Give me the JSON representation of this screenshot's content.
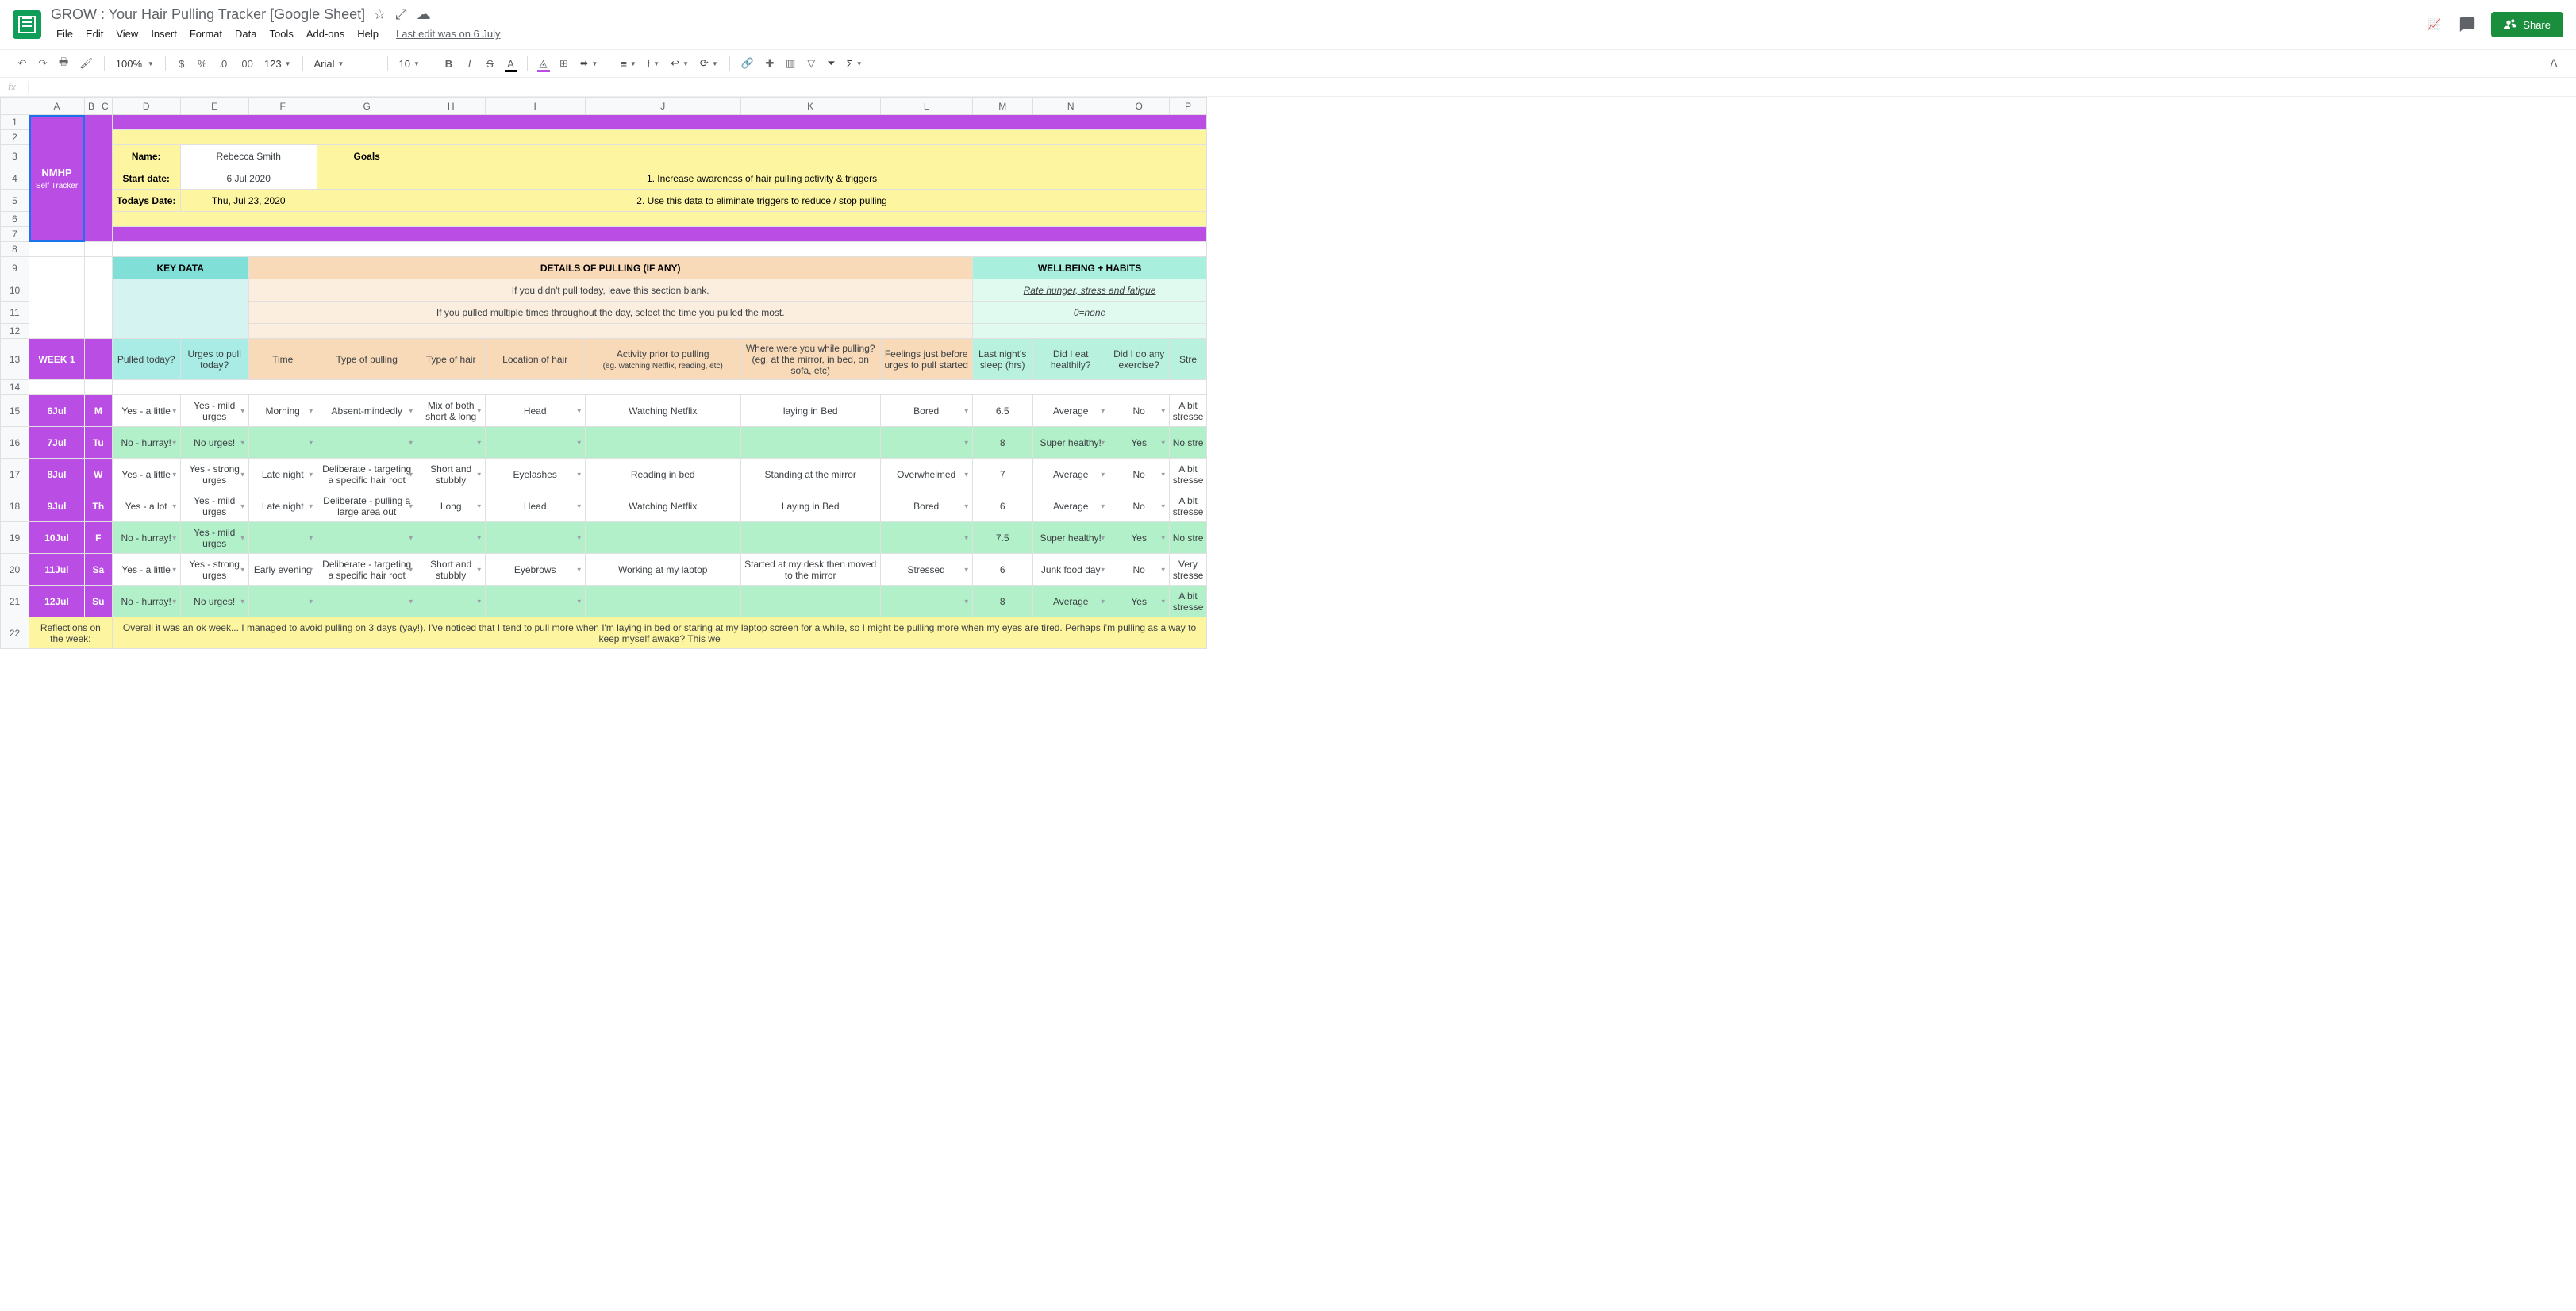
{
  "header": {
    "doc_title": "GROW : Your Hair Pulling Tracker [Google Sheet]",
    "menu": [
      "File",
      "Edit",
      "View",
      "Insert",
      "Format",
      "Data",
      "Tools",
      "Add-ons",
      "Help"
    ],
    "last_edit": "Last edit was on 6 July",
    "share": "Share"
  },
  "toolbar": {
    "zoom": "100%",
    "font": "Arial",
    "size": "10",
    "fmt123": "123"
  },
  "formula": {
    "fx": "fx",
    "value": ""
  },
  "columns": [
    "A",
    "B",
    "C",
    "D",
    "E",
    "F",
    "G",
    "H",
    "I",
    "J",
    "K",
    "L",
    "M",
    "N",
    "O",
    "P"
  ],
  "sidebar": {
    "title": "NMHP",
    "subtitle": "Self Tracker",
    "week": "WEEK 1"
  },
  "info": {
    "name_label": "Name:",
    "name_value": "Rebecca Smith",
    "start_label": "Start date:",
    "start_value": "6 Jul 2020",
    "today_label": "Todays Date:",
    "today_value": "Thu, Jul 23, 2020",
    "goals_label": "Goals",
    "goal1": "1. Increase awareness of hair pulling activity & triggers",
    "goal2": "2. Use this data to eliminate triggers to reduce / stop pulling"
  },
  "section_headers": {
    "keydata": "KEY DATA",
    "details": "DETAILS OF PULLING (IF ANY)",
    "wellbeing": "WELLBEING + HABITS",
    "details_note1": "If you didn't pull today, leave this section blank.",
    "details_note2": "If you pulled multiple times throughout the day, select the time you pulled the most.",
    "wellbeing_note": "Rate hunger, stress and fatigue",
    "wellbeing_scale": "0=none"
  },
  "col_headers": {
    "pulled": "Pulled today?",
    "urges": "Urges to pull today?",
    "time": "Time",
    "type_pull": "Type of pulling",
    "type_hair": "Type of hair",
    "location": "Location of hair",
    "activity": "Activity prior to pulling",
    "activity_sub": "(eg. watching Netflix, reading, etc)",
    "where": "Where were you while pulling? (eg. at the mirror, in bed, on sofa, etc)",
    "feelings": "Feelings just before urges to pull started",
    "sleep": "Last night's sleep (hrs)",
    "eat": "Did I eat healthily?",
    "exercise": "Did I do any exercise?",
    "stress": "Stre"
  },
  "days": [
    {
      "date": "6Jul",
      "dow": "M",
      "green": false,
      "pulled": "Yes - a little",
      "urges": "Yes - mild urges",
      "time": "Morning",
      "type_pull": "Absent-mindedly",
      "type_hair": "Mix of both short & long",
      "location": "Head",
      "activity": "Watching Netflix",
      "where": "laying in Bed",
      "feelings": "Bored",
      "sleep": "6.5",
      "eat": "Average",
      "exercise": "No",
      "stress": "A bit stresse"
    },
    {
      "date": "7Jul",
      "dow": "Tu",
      "green": true,
      "pulled": "No - hurray!",
      "urges": "No urges!",
      "time": "",
      "type_pull": "",
      "type_hair": "",
      "location": "",
      "activity": "",
      "where": "",
      "feelings": "",
      "sleep": "8",
      "eat": "Super healthy!",
      "exercise": "Yes",
      "stress": "No stre"
    },
    {
      "date": "8Jul",
      "dow": "W",
      "green": false,
      "pulled": "Yes - a little",
      "urges": "Yes - strong urges",
      "time": "Late night",
      "type_pull": "Deliberate - targeting a specific hair root",
      "type_hair": "Short and stubbly",
      "location": "Eyelashes",
      "activity": "Reading in bed",
      "where": "Standing at the mirror",
      "feelings": "Overwhelmed",
      "sleep": "7",
      "eat": "Average",
      "exercise": "No",
      "stress": "A bit stresse"
    },
    {
      "date": "9Jul",
      "dow": "Th",
      "green": false,
      "pulled": "Yes - a lot",
      "urges": "Yes - mild urges",
      "time": "Late night",
      "type_pull": "Deliberate - pulling a large area out",
      "type_hair": "Long",
      "location": "Head",
      "activity": "Watching Netflix",
      "where": "Laying in Bed",
      "feelings": "Bored",
      "sleep": "6",
      "eat": "Average",
      "exercise": "No",
      "stress": "A bit stresse"
    },
    {
      "date": "10Jul",
      "dow": "F",
      "green": true,
      "pulled": "No - hurray!",
      "urges": "Yes - mild urges",
      "time": "",
      "type_pull": "",
      "type_hair": "",
      "location": "",
      "activity": "",
      "where": "",
      "feelings": "",
      "sleep": "7.5",
      "eat": "Super healthy!",
      "exercise": "Yes",
      "stress": "No stre"
    },
    {
      "date": "11Jul",
      "dow": "Sa",
      "green": false,
      "pulled": "Yes - a little",
      "urges": "Yes - strong urges",
      "time": "Early evening",
      "type_pull": "Deliberate - targeting a specific hair root",
      "type_hair": "Short and stubbly",
      "location": "Eyebrows",
      "activity": "Working at my laptop",
      "where": "Started at my desk then moved to the mirror",
      "feelings": "Stressed",
      "sleep": "6",
      "eat": "Junk food day",
      "exercise": "No",
      "stress": "Very stresse"
    },
    {
      "date": "12Jul",
      "dow": "Su",
      "green": true,
      "pulled": "No - hurray!",
      "urges": "No urges!",
      "time": "",
      "type_pull": "",
      "type_hair": "",
      "location": "",
      "activity": "",
      "where": "",
      "feelings": "",
      "sleep": "8",
      "eat": "Average",
      "exercise": "Yes",
      "stress": "A bit stresse"
    }
  ],
  "reflection": {
    "label": "Reflections on the week:",
    "text": "Overall it was an ok week... I managed to avoid pulling on 3 days (yay!). I've noticed that I tend to pull more when I'm laying in bed or staring at my laptop screen for a while, so I might be pulling more when my eyes are tired. Perhaps i'm pulling as a way to keep myself awake? This we"
  }
}
